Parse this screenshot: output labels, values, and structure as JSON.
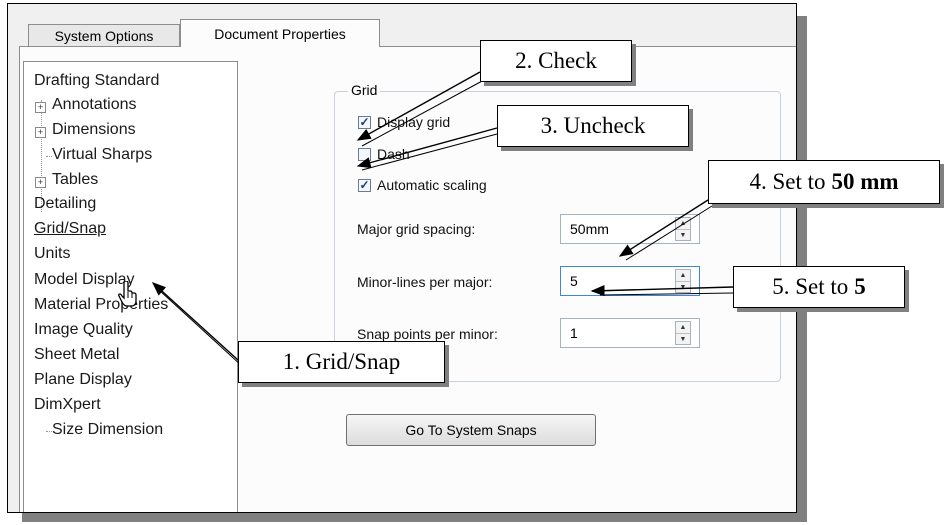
{
  "tabs": [
    {
      "label": "System Options",
      "active": false
    },
    {
      "label": "Document Properties",
      "active": true
    }
  ],
  "tree": {
    "items": [
      {
        "label": "Drafting Standard",
        "indent": 0
      },
      {
        "label": "Annotations",
        "indent": 1,
        "expander": "+"
      },
      {
        "label": "Dimensions",
        "indent": 1,
        "expander": "+"
      },
      {
        "label": "Virtual Sharps",
        "indent": 1
      },
      {
        "label": "Tables",
        "indent": 1,
        "expander": "+"
      },
      {
        "label": "Detailing",
        "indent": 0
      },
      {
        "label": "Grid/Snap",
        "indent": 0,
        "selected": true
      },
      {
        "label": "Units",
        "indent": 0
      },
      {
        "label": "Model Display",
        "indent": 0
      },
      {
        "label": "Material Properties",
        "indent": 0
      },
      {
        "label": "Image Quality",
        "indent": 0
      },
      {
        "label": "Sheet Metal",
        "indent": 0
      },
      {
        "label": "Plane Display",
        "indent": 0
      },
      {
        "label": "DimXpert",
        "indent": 0
      },
      {
        "label": "Size Dimension",
        "indent": 1
      }
    ]
  },
  "grid": {
    "legend": "Grid",
    "display_grid": {
      "label": "Display grid",
      "checked": true
    },
    "dash": {
      "label": "Dash",
      "checked": false
    },
    "auto_scaling": {
      "label": "Automatic scaling",
      "checked": true
    },
    "major_spacing": {
      "label": "Major grid spacing:",
      "value": "50mm"
    },
    "minor_per_major": {
      "label": "Minor-lines per major:",
      "value": "5"
    },
    "snap_per_minor": {
      "label": "Snap points per minor:",
      "value": "1"
    }
  },
  "go_button": "Go To System Snaps",
  "callouts": {
    "c1": "1. Grid/Snap",
    "c2": "2. Check",
    "c3": "3. Uncheck",
    "c4_prefix": "4. Set to",
    "c4_bold": "50 mm",
    "c5_prefix": "5. Set to",
    "c5_bold": "5"
  },
  "icons": {
    "cursor": "hand-pointer-icon",
    "expander": "plus-box-icon",
    "check": "checkmark-icon",
    "spin": "spin-arrows-icon"
  },
  "colors": {
    "selection_focus": "#3f87d4",
    "checkmark": "#1a3a78"
  }
}
